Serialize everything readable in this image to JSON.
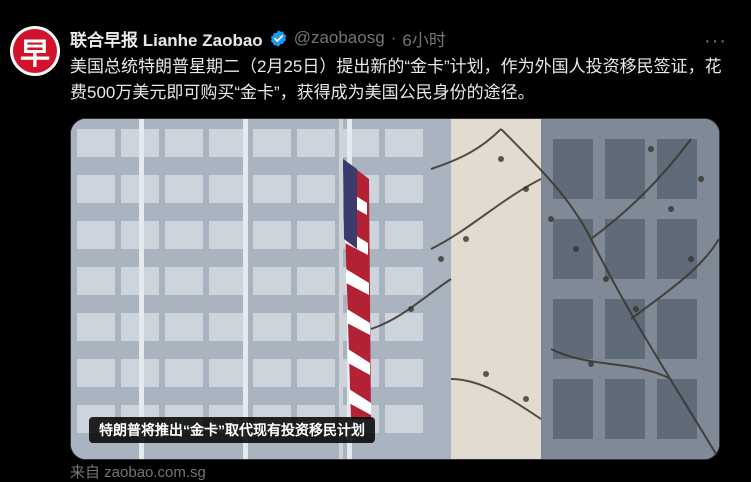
{
  "tweet": {
    "avatar_char": "早",
    "display_name": "联合早报 Lianhe Zaobao",
    "handle": "@zaobaosg",
    "dot": "·",
    "time": "6小时",
    "more": "···",
    "text": "美国总统特朗普星期二（2月25日）提出新的“金卡”计划，作为外国人投资移民签证，花费500万美元即可购买“金卡”，获得成为美国公民身份的途径。",
    "media_caption": "特朗普将推出“金卡”取代现有投资移民计划",
    "source": "来自 zaobao.com.sg"
  },
  "colors": {
    "background": "#000000",
    "text": "#e7e9ea",
    "muted": "#71767b",
    "verified": "#1d9bf0",
    "avatar": "#d0122b"
  },
  "icons": {
    "verified": "verified-badge-icon",
    "more": "more-options-icon"
  }
}
